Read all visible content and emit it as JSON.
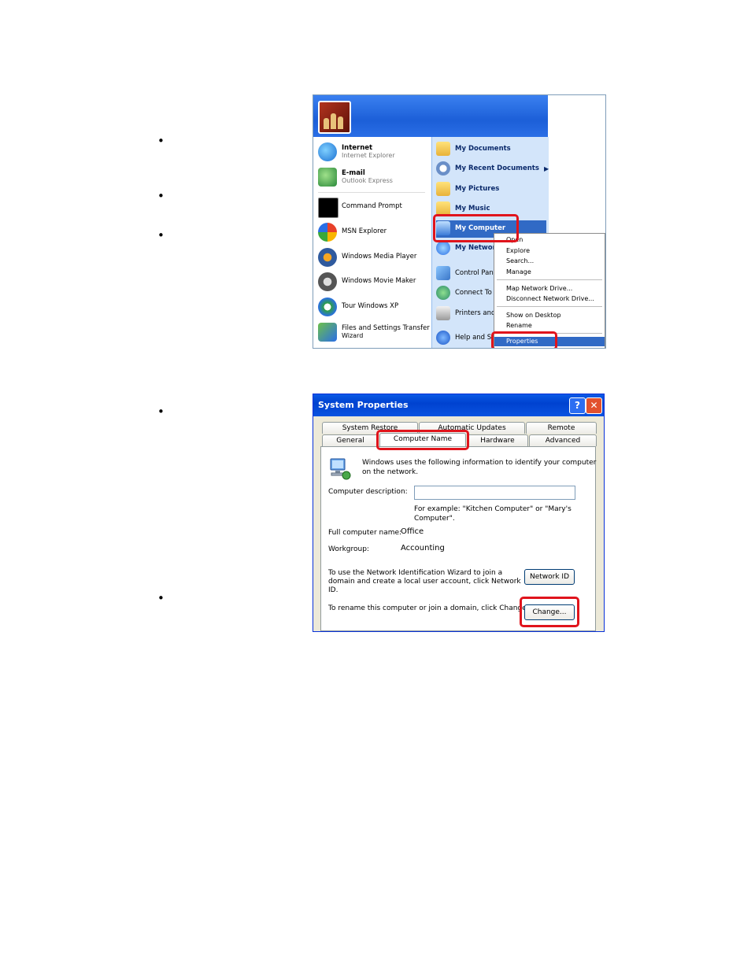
{
  "bullets": [
    "•",
    "•",
    "•",
    "•",
    "•"
  ],
  "start_menu": {
    "pinned": [
      {
        "title": "Internet",
        "subtitle": "Internet Explorer",
        "icon": "internet-explorer-icon"
      },
      {
        "title": "E-mail",
        "subtitle": "Outlook Express",
        "icon": "outlook-express-icon"
      }
    ],
    "recent": [
      {
        "label": "Command Prompt",
        "icon": "command-prompt-icon"
      },
      {
        "label": "MSN Explorer",
        "icon": "msn-butterfly-icon"
      },
      {
        "label": "Windows Media Player",
        "icon": "media-player-icon"
      },
      {
        "label": "Windows Movie Maker",
        "icon": "movie-maker-icon"
      },
      {
        "label": "Tour Windows XP",
        "icon": "tour-windows-icon"
      },
      {
        "label": "Files and Settings Transfer",
        "label2": "Wizard",
        "icon": "transfer-wizard-icon"
      }
    ],
    "places": [
      {
        "label": "My Documents",
        "icon": "folder-icon"
      },
      {
        "label": "My Recent Documents",
        "icon": "recent-documents-icon",
        "arrow": "▶"
      },
      {
        "label": "My Pictures",
        "icon": "pictures-folder-icon"
      },
      {
        "label": "My Music",
        "icon": "music-folder-icon"
      },
      {
        "label": "My Computer",
        "icon": "my-computer-icon"
      },
      {
        "label": "My Network",
        "icon": "network-icon"
      },
      {
        "label": "Control Panel",
        "icon": "control-panel-icon"
      },
      {
        "label": "Connect To",
        "icon": "connect-icon"
      },
      {
        "label": "Printers and F",
        "icon": "printer-icon"
      },
      {
        "label": "Help and Sup",
        "icon": "help-icon"
      }
    ],
    "context_menu": {
      "group1": [
        "Open",
        "Explore",
        "Search...",
        "Manage"
      ],
      "group2": [
        "Map Network Drive...",
        "Disconnect Network Drive..."
      ],
      "group3": [
        "Show on Desktop",
        "Rename"
      ],
      "group4": [
        "Properties"
      ]
    }
  },
  "system_properties": {
    "title": "System Properties",
    "help": "?",
    "close": "✕",
    "tabs_back": [
      "System Restore",
      "Automatic Updates",
      "Remote"
    ],
    "tabs_front": [
      "General",
      "Computer Name",
      "Hardware",
      "Advanced"
    ],
    "intro": "Windows uses the following information to identify your computer",
    "intro2": "on the network.",
    "description_label": "Computer description:",
    "example1": "For example: \"Kitchen Computer\" or \"Mary's",
    "example2": "Computer\".",
    "full_name_label": "Full computer name:",
    "full_name": "Office",
    "workgroup_label": "Workgroup:",
    "workgroup": "Accounting",
    "wizard_text1": "To use the Network Identification Wizard to join a",
    "wizard_text2": "domain and create a local user account, click Network",
    "wizard_text3": "ID.",
    "network_id_button": "Network ID",
    "rename_text": "To rename this computer or join a domain, click Change.",
    "change_button": "Change..."
  },
  "colors": {
    "highlight_box": "#e0141c",
    "xp_blue": "#0a5ae6",
    "selection": "#316ac5"
  }
}
